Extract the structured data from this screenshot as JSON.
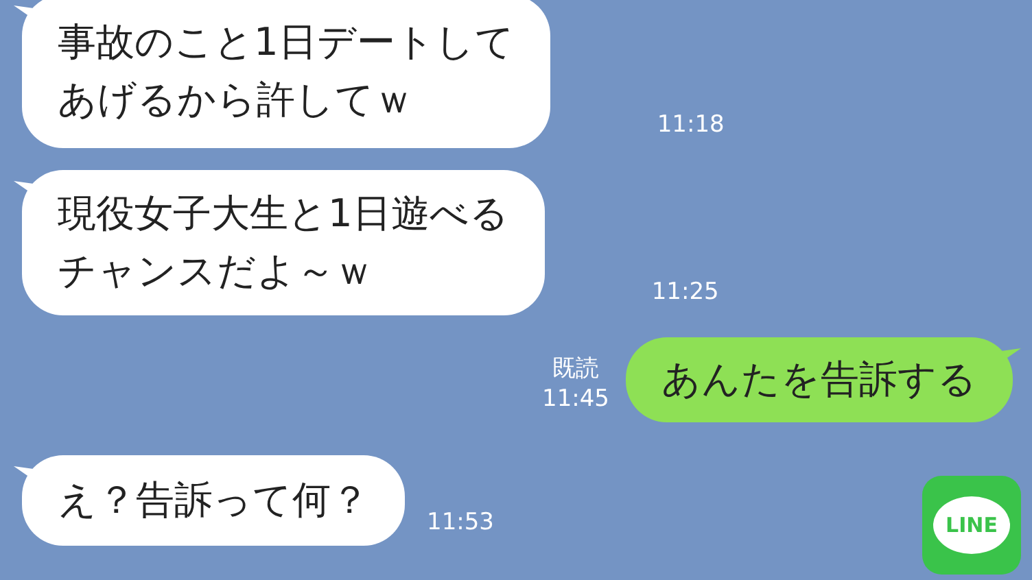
{
  "messages": [
    {
      "kind": "received",
      "lines": [
        "事故のこと1日デートして",
        "あげるから許してｗ"
      ],
      "time": "11:18"
    },
    {
      "kind": "received",
      "lines": [
        "現役女子大生と1日遊べる",
        "チャンスだよ～ｗ"
      ],
      "time": "11:25"
    },
    {
      "kind": "sent",
      "lines": [
        "あんたを告訴する"
      ],
      "read": "既読",
      "time": "11:45"
    },
    {
      "kind": "received",
      "lines": [
        "え？告訴って何？"
      ],
      "time": "11:53"
    }
  ],
  "logo": {
    "text": "LINE"
  }
}
